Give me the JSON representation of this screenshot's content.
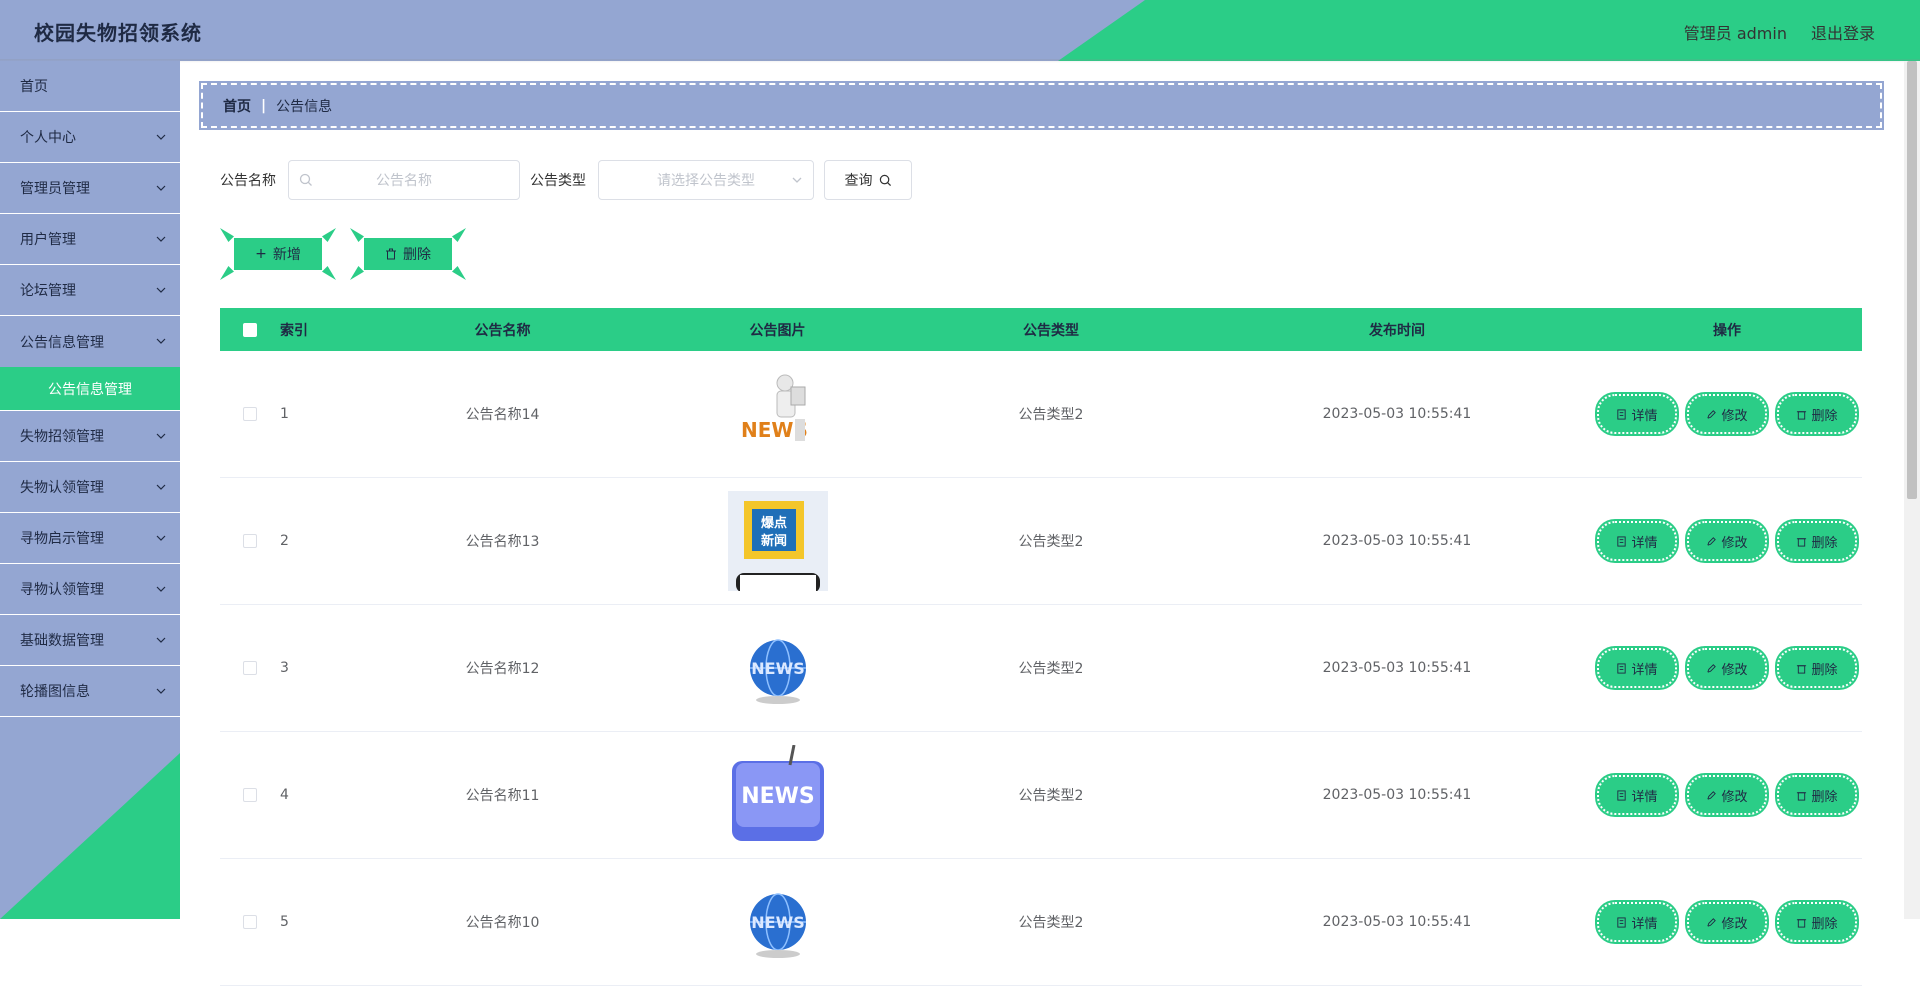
{
  "header": {
    "title": "校园失物招领系统",
    "user_label": "管理员 admin",
    "logout_label": "退出登录"
  },
  "sidebar": {
    "items": [
      {
        "label": "首页",
        "has_children": false
      },
      {
        "label": "个人中心",
        "has_children": true
      },
      {
        "label": "管理员管理",
        "has_children": true
      },
      {
        "label": "用户管理",
        "has_children": true
      },
      {
        "label": "论坛管理",
        "has_children": true
      },
      {
        "label": "公告信息管理",
        "has_children": true,
        "expanded": true
      },
      {
        "label": "失物招领管理",
        "has_children": true
      },
      {
        "label": "失物认领管理",
        "has_children": true
      },
      {
        "label": "寻物启示管理",
        "has_children": true
      },
      {
        "label": "寻物认领管理",
        "has_children": true
      },
      {
        "label": "基础数据管理",
        "has_children": true
      },
      {
        "label": "轮播图信息",
        "has_children": true
      }
    ],
    "active_sub": "公告信息管理"
  },
  "breadcrumb": {
    "home": "首页",
    "current": "公告信息"
  },
  "search": {
    "name_label": "公告名称",
    "name_placeholder": "公告名称",
    "type_label": "公告类型",
    "type_placeholder": "请选择公告类型",
    "query_label": "查询"
  },
  "actions": {
    "add_label": "新增",
    "delete_label": "删除"
  },
  "table": {
    "headers": {
      "index": "索引",
      "name": "公告名称",
      "image": "公告图片",
      "type": "公告类型",
      "time": "发布时间",
      "ops": "操作"
    },
    "op_labels": {
      "detail": "详情",
      "edit": "修改",
      "delete": "删除"
    },
    "rows": [
      {
        "index": "1",
        "name": "公告名称14",
        "image": "news-figure-thumb",
        "type": "公告类型2",
        "time": "2023-05-03 10:55:41"
      },
      {
        "index": "2",
        "name": "公告名称13",
        "image": "breaking-news-phone-thumb",
        "type": "公告类型2",
        "time": "2023-05-03 10:55:41"
      },
      {
        "index": "3",
        "name": "公告名称12",
        "image": "news-globe-thumb",
        "type": "公告类型2",
        "time": "2023-05-03 10:55:41"
      },
      {
        "index": "4",
        "name": "公告名称11",
        "image": "news-key-thumb",
        "type": "公告类型2",
        "time": "2023-05-03 10:55:41"
      },
      {
        "index": "5",
        "name": "公告名称10",
        "image": "news-globe-thumb",
        "type": "公告类型2",
        "time": "2023-05-03 10:55:41"
      }
    ]
  },
  "colors": {
    "primary_blue": "#94a6d2",
    "accent_green": "#2bcd87"
  }
}
